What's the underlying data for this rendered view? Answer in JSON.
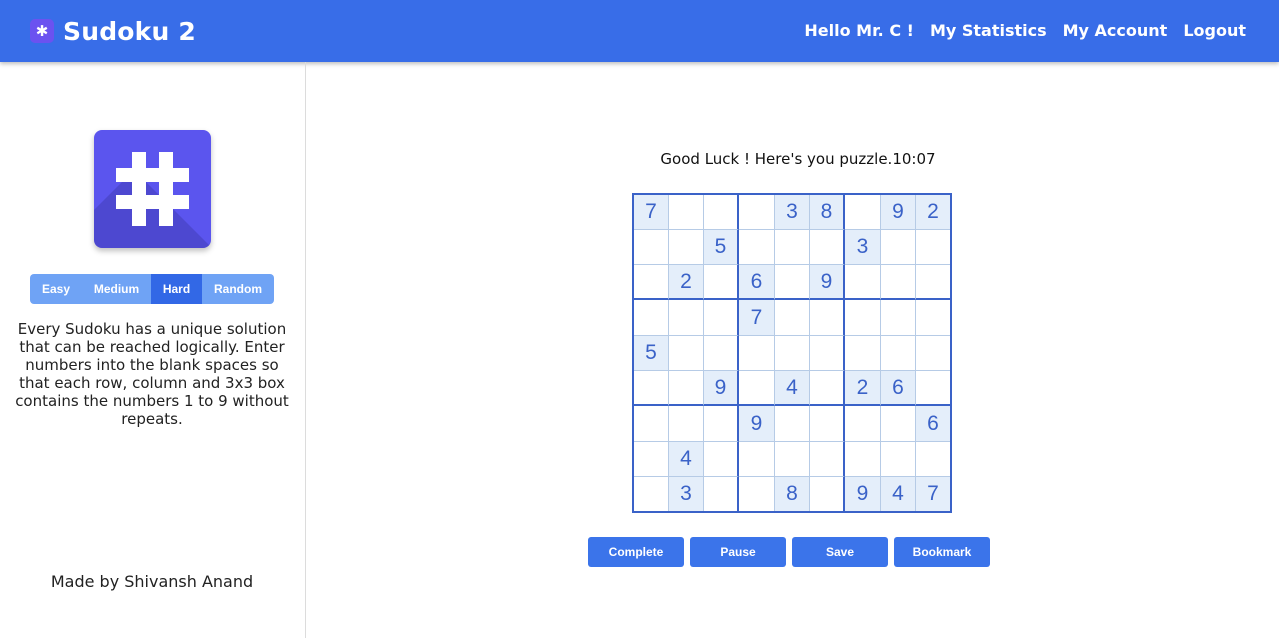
{
  "app": {
    "title": "Sudoku 2",
    "logo_icon": "gear-icon"
  },
  "nav": {
    "greeting": "Hello Mr. C !",
    "statistics": "My Statistics",
    "account": "My Account",
    "logout": "Logout"
  },
  "sidebar": {
    "logo_icon": "hash-icon",
    "levels": [
      "Easy",
      "Medium",
      "Hard",
      "Random"
    ],
    "active_level": "Hard",
    "description": "Every Sudoku has a unique solution that can be reached logically. Enter numbers into the blank spaces so that each row, column and 3x3 box contains the numbers 1 to 9 without repeats.",
    "credit": "Made by Shivansh Anand"
  },
  "game": {
    "message": "Good Luck ! Here's you puzzle.10:07",
    "board": [
      [
        "7",
        "",
        "",
        "",
        "3",
        "8",
        "",
        "9",
        "2"
      ],
      [
        "",
        "",
        "5",
        "",
        "",
        "",
        "3",
        "",
        ""
      ],
      [
        "",
        "2",
        "",
        "6",
        "",
        "9",
        "",
        "",
        ""
      ],
      [
        "",
        "",
        "",
        "7",
        "",
        "",
        "",
        "",
        ""
      ],
      [
        "5",
        "",
        "",
        "",
        "",
        "",
        "",
        "",
        ""
      ],
      [
        "",
        "",
        "9",
        "",
        "4",
        "",
        "2",
        "6",
        ""
      ],
      [
        "",
        "",
        "",
        "9",
        "",
        "",
        "",
        "",
        "6"
      ],
      [
        "",
        "4",
        "",
        "",
        "",
        "",
        "",
        "",
        ""
      ],
      [
        "",
        "3",
        "",
        "",
        "8",
        "",
        "9",
        "4",
        "7"
      ]
    ],
    "actions": [
      "Complete",
      "Pause",
      "Save",
      "Bookmark"
    ]
  },
  "colors": {
    "navbar": "#386de8",
    "accent": "#3b74ea",
    "board_line": "#3a62c8",
    "given_cell": "#e4eefa"
  }
}
